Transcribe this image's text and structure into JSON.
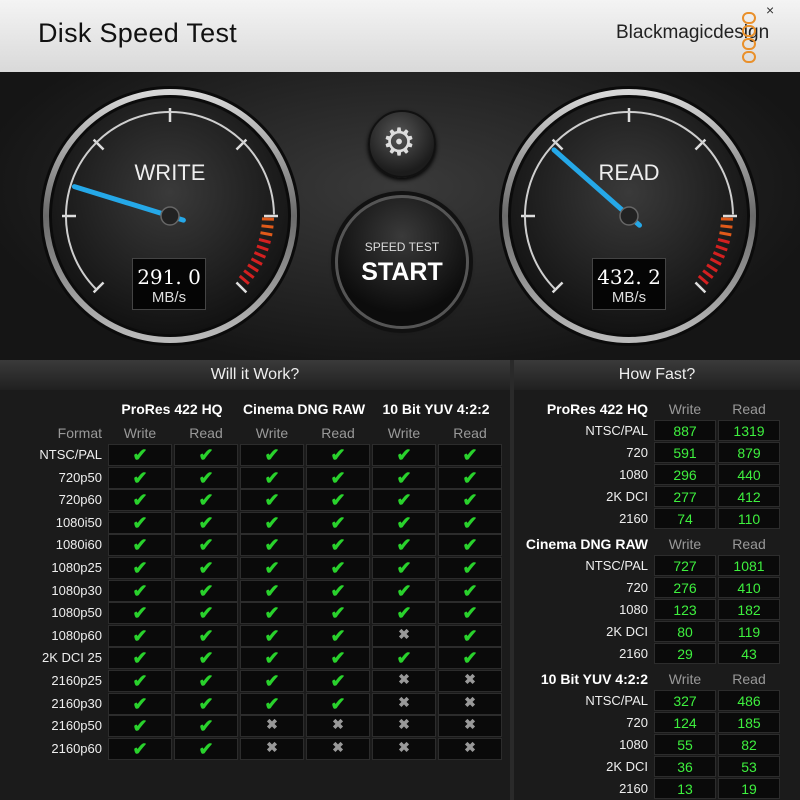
{
  "app": {
    "title": "Disk Speed Test",
    "brand": "Blackmagicdesign",
    "close_glyph": "×"
  },
  "write_gauge": {
    "label": "WRITE",
    "value": "291. 0",
    "unit": "MB/s",
    "fraction": 0.23
  },
  "read_gauge": {
    "label": "READ",
    "value": "432. 2",
    "unit": "MB/s",
    "fraction": 0.32
  },
  "settings": {
    "icon": "gear-icon"
  },
  "start": {
    "line1": "SPEED TEST",
    "line2": "START"
  },
  "will_it_work": {
    "title": "Will it Work?",
    "format_label": "Format",
    "codecs": [
      "ProRes 422 HQ",
      "Cinema DNG RAW",
      "10 Bit YUV 4:2:2"
    ],
    "subheads": [
      "Write",
      "Read"
    ],
    "check_glyph": "✔",
    "cross_glyph": "✖",
    "rows": [
      {
        "format": "NTSC/PAL",
        "r": [
          1,
          1,
          1,
          1,
          1,
          1
        ]
      },
      {
        "format": "720p50",
        "r": [
          1,
          1,
          1,
          1,
          1,
          1
        ]
      },
      {
        "format": "720p60",
        "r": [
          1,
          1,
          1,
          1,
          1,
          1
        ]
      },
      {
        "format": "1080i50",
        "r": [
          1,
          1,
          1,
          1,
          1,
          1
        ]
      },
      {
        "format": "1080i60",
        "r": [
          1,
          1,
          1,
          1,
          1,
          1
        ]
      },
      {
        "format": "1080p25",
        "r": [
          1,
          1,
          1,
          1,
          1,
          1
        ]
      },
      {
        "format": "1080p30",
        "r": [
          1,
          1,
          1,
          1,
          1,
          1
        ]
      },
      {
        "format": "1080p50",
        "r": [
          1,
          1,
          1,
          1,
          1,
          1
        ]
      },
      {
        "format": "1080p60",
        "r": [
          1,
          1,
          1,
          1,
          0,
          1
        ]
      },
      {
        "format": "2K DCI 25",
        "r": [
          1,
          1,
          1,
          1,
          1,
          1
        ]
      },
      {
        "format": "2160p25",
        "r": [
          1,
          1,
          1,
          1,
          0,
          0
        ]
      },
      {
        "format": "2160p30",
        "r": [
          1,
          1,
          1,
          1,
          0,
          0
        ]
      },
      {
        "format": "2160p50",
        "r": [
          1,
          1,
          0,
          0,
          0,
          0
        ]
      },
      {
        "format": "2160p60",
        "r": [
          1,
          1,
          0,
          0,
          0,
          0
        ]
      }
    ]
  },
  "how_fast": {
    "title": "How Fast?",
    "write_label": "Write",
    "read_label": "Read",
    "groups": [
      {
        "name": "ProRes 422 HQ",
        "rows": [
          {
            "label": "NTSC/PAL",
            "write": "887",
            "read": "1319"
          },
          {
            "label": "720",
            "write": "591",
            "read": "879"
          },
          {
            "label": "1080",
            "write": "296",
            "read": "440"
          },
          {
            "label": "2K DCI",
            "write": "277",
            "read": "412"
          },
          {
            "label": "2160",
            "write": "74",
            "read": "110"
          }
        ]
      },
      {
        "name": "Cinema DNG RAW",
        "rows": [
          {
            "label": "NTSC/PAL",
            "write": "727",
            "read": "1081"
          },
          {
            "label": "720",
            "write": "276",
            "read": "410"
          },
          {
            "label": "1080",
            "write": "123",
            "read": "182"
          },
          {
            "label": "2K DCI",
            "write": "80",
            "read": "119"
          },
          {
            "label": "2160",
            "write": "29",
            "read": "43"
          }
        ]
      },
      {
        "name": "10 Bit YUV 4:2:2",
        "rows": [
          {
            "label": "NTSC/PAL",
            "write": "327",
            "read": "486"
          },
          {
            "label": "720",
            "write": "124",
            "read": "185"
          },
          {
            "label": "1080",
            "write": "55",
            "read": "82"
          },
          {
            "label": "2K DCI",
            "write": "36",
            "read": "53"
          },
          {
            "label": "2160",
            "write": "13",
            "read": "19"
          }
        ]
      }
    ]
  }
}
